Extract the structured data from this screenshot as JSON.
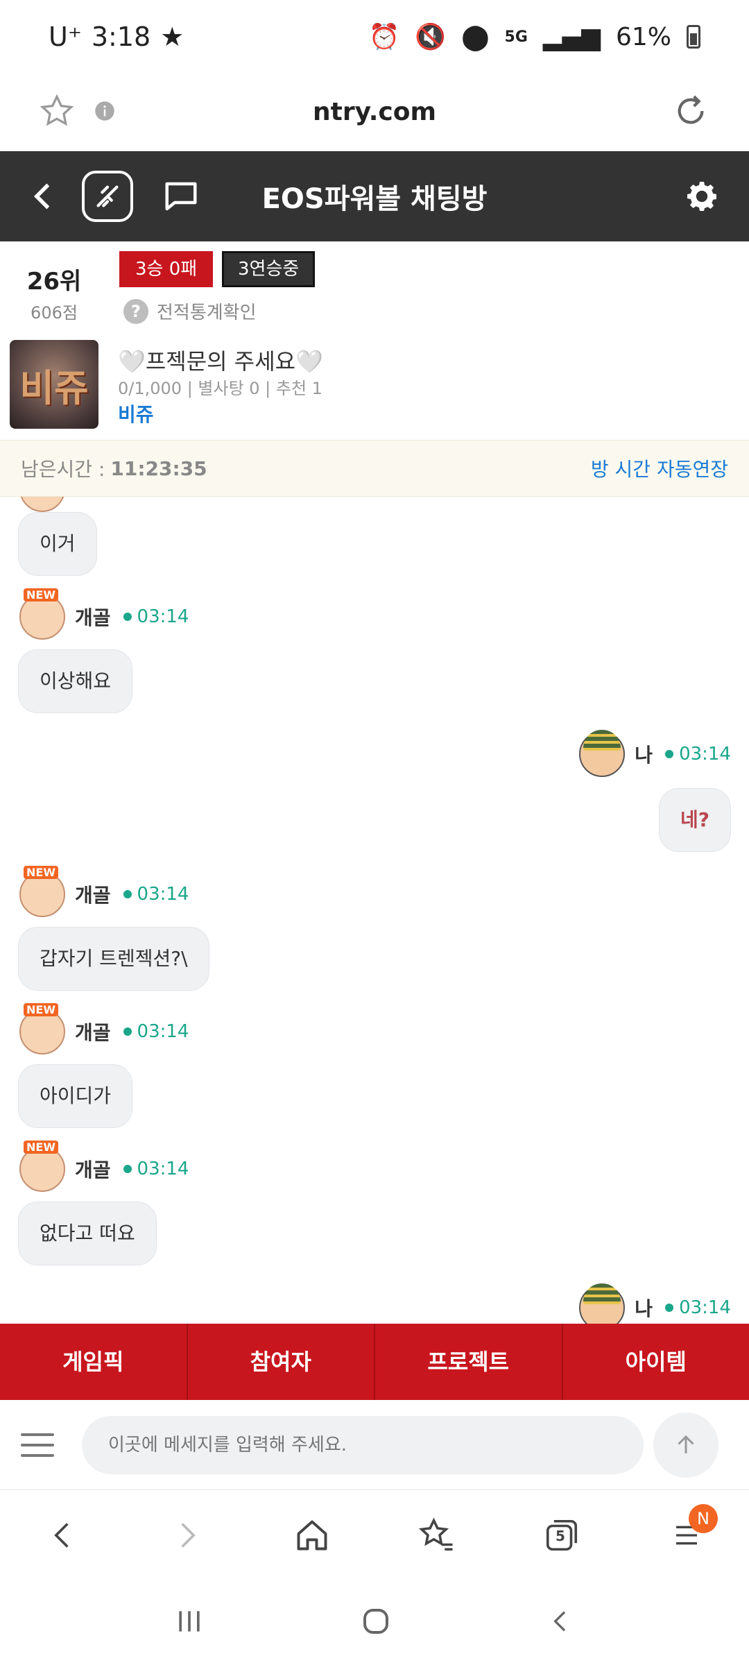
{
  "status_bar": {
    "carrier": "U⁺",
    "time": "3:18",
    "network": "5G",
    "battery": "61%"
  },
  "browser": {
    "url": "ntry.com",
    "tabs_count": "5",
    "notification_badge": "N"
  },
  "header": {
    "title": "EOS파워볼 채팅방"
  },
  "room": {
    "rank": "26위",
    "points": "606점",
    "record_badge": "3승 0패",
    "streak_badge": "3연승중",
    "stats_link": "전적통계확인",
    "title": "🤍프젝문의 주세요🤍",
    "meta": "0/1,000 | 별사탕 0 | 추천 1",
    "owner": "비쥬",
    "avatar_text": "비쥬",
    "remaining_label": "남은시간 :",
    "remaining_time": "11:23:35",
    "extend_link": "방 시간 자동연장"
  },
  "messages": [
    {
      "sender": "",
      "time": "",
      "text": "이거",
      "mine": false
    },
    {
      "sender": "개골",
      "time": "03:14",
      "text": "이상해요",
      "mine": false
    },
    {
      "sender": "나",
      "time": "03:14",
      "text": "네?",
      "mine": true
    },
    {
      "sender": "개골",
      "time": "03:14",
      "text": "갑자기 트렌젝션?\\",
      "mine": false
    },
    {
      "sender": "개골",
      "time": "03:14",
      "text": "아이디가",
      "mine": false
    },
    {
      "sender": "개골",
      "time": "03:14",
      "text": "없다고 떠요",
      "mine": false
    },
    {
      "sender": "나",
      "time": "03:14",
      "text": "",
      "mine": true
    }
  ],
  "tabs": [
    "게임픽",
    "참여자",
    "프로젝트",
    "아이템"
  ],
  "input": {
    "placeholder": "이곳에 메세지를 입력해 주세요."
  },
  "colors": {
    "header_bg": "#333333",
    "accent_red": "#c8161e",
    "link_blue": "#1a7ad4",
    "online_green": "#1aa68a"
  }
}
